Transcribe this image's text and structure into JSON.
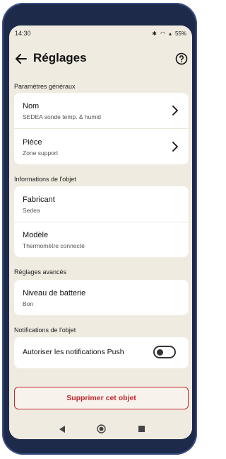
{
  "status_bar": {
    "time": "14:30",
    "battery": "55%"
  },
  "header": {
    "title": "Réglages"
  },
  "sections": {
    "general": {
      "label": "Paramètres généraux",
      "name": {
        "title": "Nom",
        "value": "SEDEA sonde temp. & humid"
      },
      "room": {
        "title": "Pièce",
        "value": "Zone support"
      }
    },
    "info": {
      "label": "Informations de l'objet",
      "maker": {
        "title": "Fabricant",
        "value": "Sedea"
      },
      "model": {
        "title": "Modèle",
        "value": "Thermomètre connecté"
      }
    },
    "advanced": {
      "label": "Réglages avancés",
      "battery": {
        "title": "Niveau de batterie",
        "value": "Bon"
      }
    },
    "notifications": {
      "label": "Notifications de l'objet",
      "push_label": "Autoriser les notifications Push",
      "push_enabled": false
    }
  },
  "actions": {
    "delete_label": "Supprimer cet objet"
  },
  "colors": {
    "background": "#f0ebe1",
    "danger": "#c0262e",
    "card": "#ffffff"
  }
}
